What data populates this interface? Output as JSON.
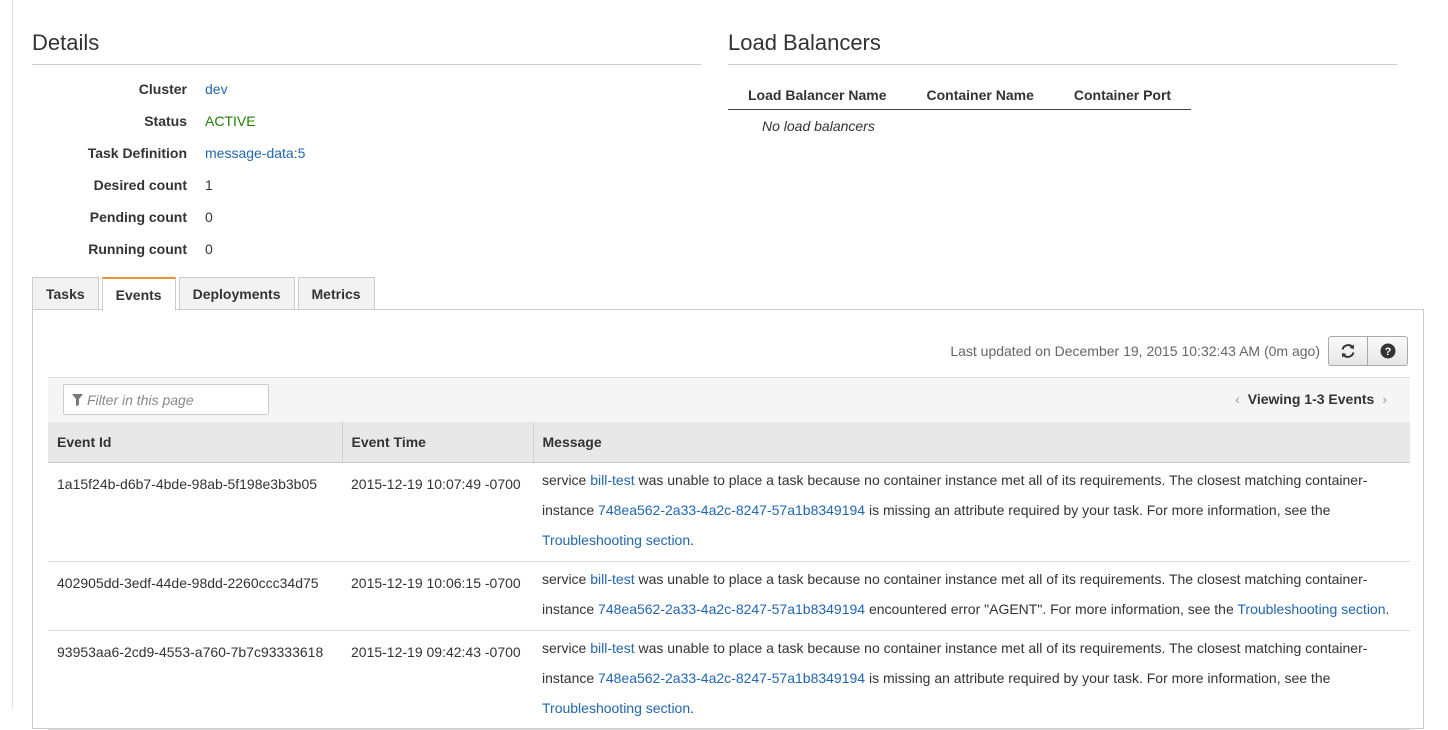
{
  "details": {
    "title": "Details",
    "rows": [
      {
        "label": "Cluster",
        "value": "dev"
      },
      {
        "label": "Status",
        "value": "ACTIVE"
      },
      {
        "label": "Task Definition",
        "value": "message-data:5"
      },
      {
        "label": "Desired count",
        "value": "1"
      },
      {
        "label": "Pending count",
        "value": "0"
      },
      {
        "label": "Running count",
        "value": "0"
      }
    ]
  },
  "load_balancers": {
    "title": "Load Balancers",
    "columns": [
      "Load Balancer Name",
      "Container Name",
      "Container Port"
    ],
    "empty_text": "No load balancers"
  },
  "tabs": [
    {
      "label": "Tasks",
      "active": false
    },
    {
      "label": "Events",
      "active": true
    },
    {
      "label": "Deployments",
      "active": false
    },
    {
      "label": "Metrics",
      "active": false
    }
  ],
  "events_panel": {
    "last_updated": "Last updated on December 19, 2015 10:32:43 AM (0m ago)",
    "refresh_icon": "refresh-icon",
    "help_icon": "help-icon",
    "filter_placeholder": "Filter in this page",
    "filter_icon": "filter-icon",
    "pager_text": "Viewing 1-3 Events",
    "columns": [
      "Event Id",
      "Event Time",
      "Message"
    ],
    "rows": [
      {
        "id": "1a15f24b-d6b7-4bde-98ab-5f198e3b3b05",
        "time": "2015-12-19 10:07:49 -0700",
        "msg_1": "service ",
        "service": "bill-test",
        "msg_2": " was unable to place a task because no container instance met all of its requirements. The closest matching container-instance ",
        "instance": "748ea562-2a33-4a2c-8247-57a1b8349194",
        "msg_3": " is missing an attribute required by your task. For more information, see the ",
        "link": "Troubleshooting section",
        "msg_4": "."
      },
      {
        "id": "402905dd-3edf-44de-98dd-2260ccc34d75",
        "time": "2015-12-19 10:06:15 -0700",
        "msg_1": "service ",
        "service": "bill-test",
        "msg_2": " was unable to place a task because no container instance met all of its requirements. The closest matching container-instance ",
        "instance": "748ea562-2a33-4a2c-8247-57a1b8349194",
        "msg_3": " encountered error \"AGENT\". For more information, see the ",
        "link": "Troubleshooting section",
        "msg_4": "."
      },
      {
        "id": "93953aa6-2cd9-4553-a760-7b7c93333618",
        "time": "2015-12-19 09:42:43 -0700",
        "msg_1": "service ",
        "service": "bill-test",
        "msg_2": " was unable to place a task because no container instance met all of its requirements. The closest matching container-instance ",
        "instance": "748ea562-2a33-4a2c-8247-57a1b8349194",
        "msg_3": " is missing an attribute required by your task. For more information, see the ",
        "link": "Troubleshooting section",
        "msg_4": "."
      }
    ]
  },
  "colors": {
    "link": "#1f66b5",
    "active_status": "#1d8102",
    "active_tab_accent": "#e5972e"
  }
}
